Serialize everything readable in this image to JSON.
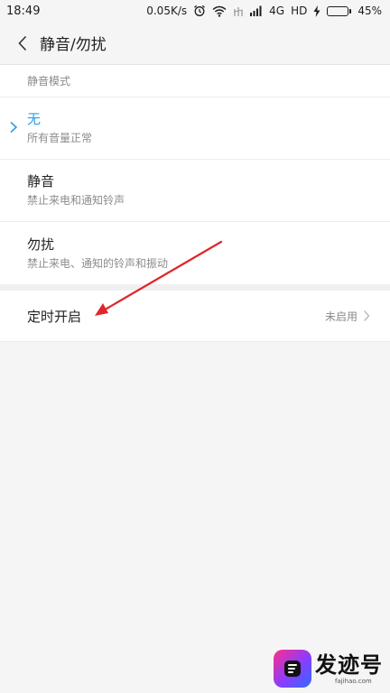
{
  "status_bar": {
    "time": "18:49",
    "speed": "0.05K/s",
    "network": "4G",
    "hd": "HD",
    "battery": "45%",
    "battery_level": 0.45
  },
  "header": {
    "title": "静音/勿扰"
  },
  "section": {
    "label": "静音模式"
  },
  "modes": [
    {
      "title": "无",
      "desc": "所有音量正常",
      "selected": true
    },
    {
      "title": "静音",
      "desc": "禁止来电和通知铃声",
      "selected": false
    },
    {
      "title": "勿扰",
      "desc": "禁止来电、通知的铃声和振动",
      "selected": false
    }
  ],
  "schedule": {
    "label": "定时开启",
    "value": "未启用"
  },
  "watermark": {
    "brand": "发迹号",
    "url": "fajihao.com"
  },
  "colors": {
    "accent": "#2b9cf0",
    "annotation": "#e0262b"
  }
}
